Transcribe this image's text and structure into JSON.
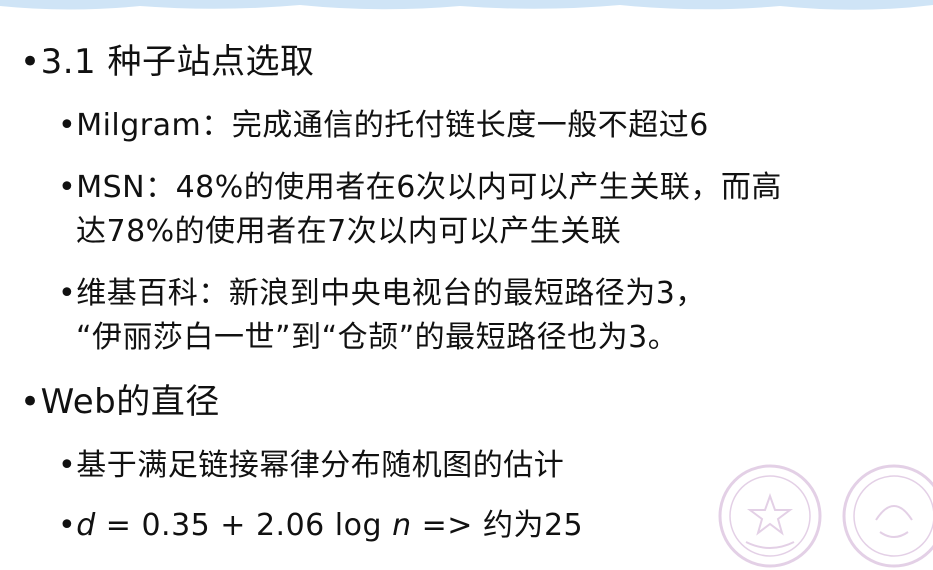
{
  "bullet": "•",
  "items": [
    {
      "level": 1,
      "text": "3.1 种子站点选取"
    },
    {
      "level": 2,
      "text": "Milgram：完成通信的托付链长度一般不超过6"
    },
    {
      "level": 2,
      "text": "MSN：48%的使用者在6次以内可以产生关联，而高"
    },
    {
      "level": 2,
      "text": "达78%的使用者在7次以内可以产生关联",
      "continuation": true
    },
    {
      "level": 2,
      "text": "维基百科：新浪到中央电视台的最短路径为3，"
    },
    {
      "level": 2,
      "text": "“伊丽莎白一世”到“仓颉”的最短路径也为3。",
      "continuation": true
    },
    {
      "level": 1,
      "text": "Web的直径"
    },
    {
      "level": 2,
      "text": "基于满足链接幂律分布随机图的估计"
    }
  ],
  "formula": {
    "var_d": "d",
    "part1": " = 0.35 + 2.06 log ",
    "var_n": "n",
    "part2": " => 约为25"
  },
  "colors": {
    "text": "#111111",
    "deco": "#cfe4f6",
    "seal": "#b27ab8"
  }
}
